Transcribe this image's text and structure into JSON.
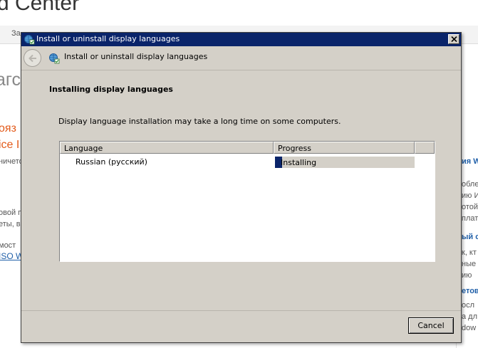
{
  "background_page": {
    "heading": "d Center",
    "bar_text": "За",
    "large_text": "агс",
    "orange_1": "ояз",
    "orange_2": "ice I",
    "text_1": "ничето",
    "text_2": "овой п",
    "text_3": "еты, в",
    "text_4": "мост",
    "link_1": "ISO W",
    "right_1": "ия W",
    "right_2": "обле",
    "right_3": "ию И",
    "right_4": "отой",
    "right_5": "плат",
    "right_6": "ый с",
    "right_7": "к, кт",
    "right_8": "ные",
    "right_9": "ию",
    "right_10": "етов",
    "right_11": "осл",
    "right_12": "а дл",
    "right_13": "dow"
  },
  "dialog": {
    "title": "Install or uninstall display languages",
    "header_title": "Install or uninstall display languages",
    "section_title": "Installing display languages",
    "description": "Display language installation may take a long time on some computers.",
    "columns": {
      "language": "Language",
      "progress": "Progress"
    },
    "rows": [
      {
        "language": "Russian (русский)",
        "status": "Installing",
        "progress": 0.05
      }
    ],
    "cancel_label": "Cancel"
  },
  "colors": {
    "titlebar": "#0a246a",
    "dialog_face": "#d4d0c8",
    "progress_fill": "#0a246a"
  },
  "icons": {
    "title_icon": "globe-language-icon",
    "back": "back-arrow-icon",
    "header_icon": "globe-language-icon",
    "close": "close-icon"
  }
}
